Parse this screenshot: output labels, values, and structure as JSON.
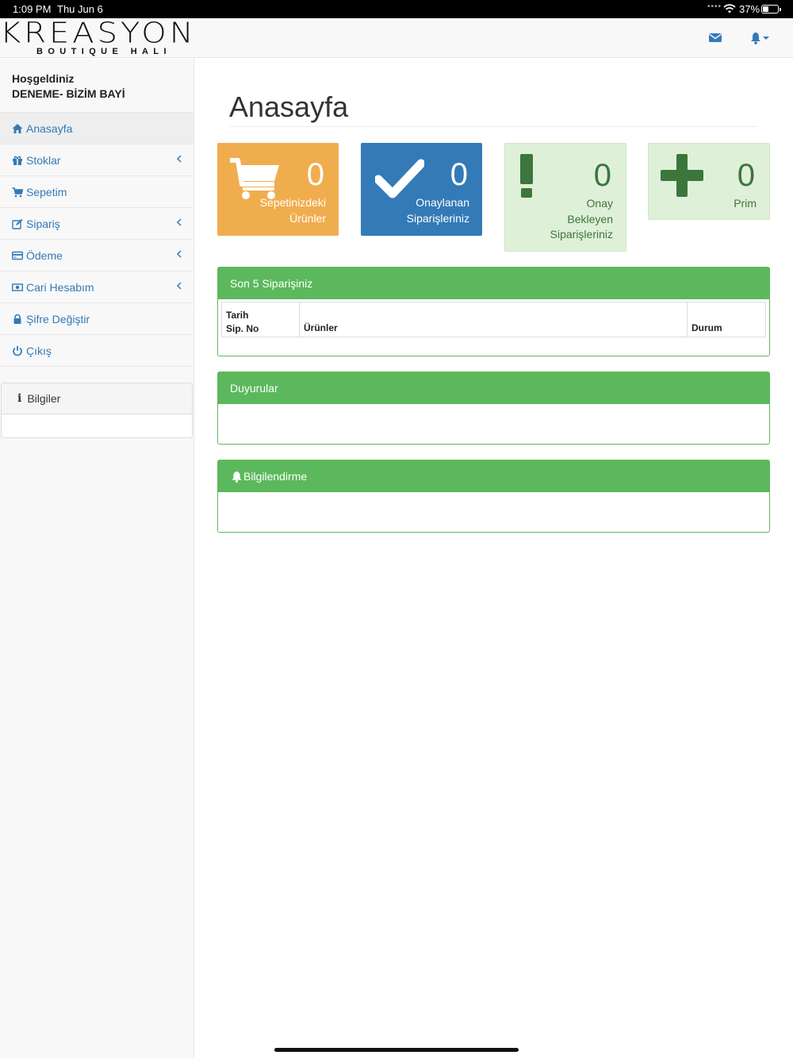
{
  "status_bar": {
    "time": "1:09 PM",
    "date": "Thu Jun 6",
    "battery": "37%"
  },
  "brand": {
    "name": "KREASYON",
    "tagline": "BOUTIQUE HALI"
  },
  "sidebar": {
    "welcome_line1": "Hoşgeldiniz",
    "welcome_line2": "DENEME- BİZİM BAYİ",
    "items": [
      {
        "label": "Anasayfa",
        "icon": "home-icon"
      },
      {
        "label": "Stoklar",
        "icon": "gift-icon"
      },
      {
        "label": "Sepetim",
        "icon": "cart-icon"
      },
      {
        "label": "Sipariş",
        "icon": "edit-icon"
      },
      {
        "label": "Ödeme",
        "icon": "credit-card-icon"
      },
      {
        "label": "Cari Hesabım",
        "icon": "money-icon"
      },
      {
        "label": "Şifre Değiştir",
        "icon": "lock-icon"
      },
      {
        "label": "Çıkış",
        "icon": "power-icon"
      }
    ],
    "info_panel_title": "Bilgiler"
  },
  "main": {
    "title": "Anasayfa",
    "tiles": [
      {
        "value": "0",
        "label_lines": [
          "Sepetinizdeki",
          "Ürünler"
        ],
        "color": "#f0ad4e"
      },
      {
        "value": "0",
        "label_lines": [
          "Onaylanan",
          "Siparişleriniz"
        ],
        "color": "#337ab7"
      },
      {
        "value": "0",
        "label_lines": [
          "Onay",
          "Bekleyen",
          "Siparişleriniz"
        ],
        "color": "#dff0d8"
      },
      {
        "value": "0",
        "label_lines": [
          "Prim"
        ],
        "color": "#dff0d8"
      }
    ],
    "orders_panel": {
      "title": "Son 5 Siparişiniz",
      "columns": {
        "date": "Tarih",
        "order_no": "Sip. No",
        "products": "Ürünler",
        "status": "Durum"
      }
    },
    "news_panel": {
      "title": "Duyurular"
    },
    "notify_panel": {
      "title": "Bilgilendirme"
    }
  },
  "colors": {
    "accent": "#337ab7",
    "success": "#5cb85c",
    "warning": "#f0ad4e"
  }
}
